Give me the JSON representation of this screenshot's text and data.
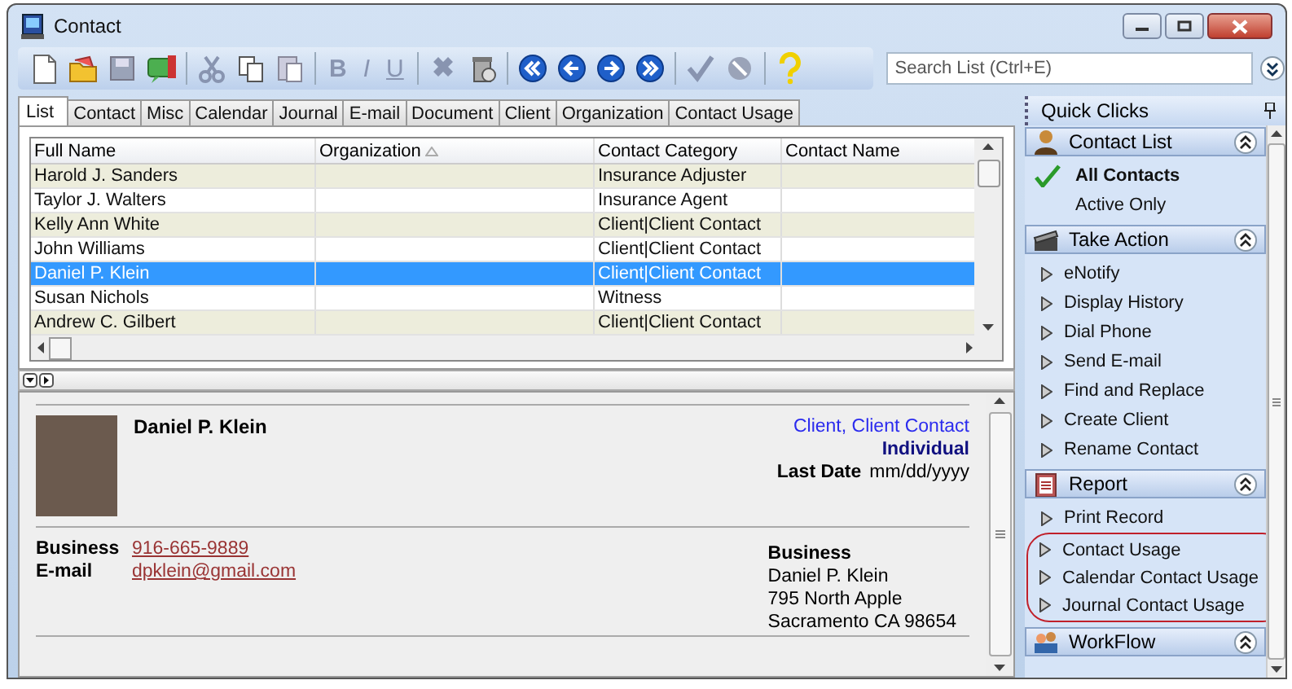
{
  "window": {
    "title": "Contact"
  },
  "toolbar": {
    "format_buttons": [
      "B",
      "I",
      "U"
    ],
    "search": {
      "placeholder": "Search List (Ctrl+E)"
    }
  },
  "tabs": [
    {
      "label": "List",
      "selected": true
    },
    {
      "label": "Contact",
      "selected": false
    },
    {
      "label": "Misc",
      "selected": false
    },
    {
      "label": "Calendar",
      "selected": false
    },
    {
      "label": "Journal",
      "selected": false
    },
    {
      "label": "E-mail",
      "selected": false
    },
    {
      "label": "Document",
      "selected": false
    },
    {
      "label": "Client",
      "selected": false
    },
    {
      "label": "Organization",
      "selected": false
    },
    {
      "label": "Contact Usage",
      "selected": false
    }
  ],
  "table": {
    "columns": [
      {
        "label": "Full Name",
        "sorted": false
      },
      {
        "label": "Organization",
        "sorted": true
      },
      {
        "label": "Contact Category",
        "sorted": false
      },
      {
        "label": "Contact Name",
        "sorted": false
      }
    ],
    "rows": [
      {
        "full_name": "Harold J. Sanders",
        "contact_category": "Insurance Adjuster",
        "selected": false
      },
      {
        "full_name": "Taylor J. Walters",
        "contact_category": "Insurance Agent",
        "selected": false
      },
      {
        "full_name": "Kelly Ann White",
        "contact_category": "Client|Client Contact",
        "selected": false
      },
      {
        "full_name": "John Williams",
        "contact_category": "Client|Client Contact",
        "selected": false
      },
      {
        "full_name": "Daniel P. Klein",
        "contact_category": "Client|Client Contact",
        "selected": true
      },
      {
        "full_name": "Susan Nichols",
        "contact_category": "Witness",
        "selected": false
      },
      {
        "full_name": "Andrew C. Gilbert",
        "contact_category": "Client|Client Contact",
        "selected": false
      }
    ]
  },
  "detail": {
    "name": "Daniel P. Klein",
    "category": "Client, Client Contact",
    "type": "Individual",
    "last_date_label": "Last Date",
    "last_date": "mm/dd/yyyy",
    "phone_label": "Business",
    "phone": "916-665-9889",
    "email_label": "E-mail",
    "email": "dpklein@gmail.com",
    "address_label": "Business",
    "address_lines": [
      "Daniel P. Klein",
      "795 North Apple",
      "Sacramento  CA  98654"
    ]
  },
  "quick_clicks": {
    "title": "Quick Clicks",
    "sections": [
      {
        "title": "Contact List",
        "items": [
          {
            "label": "All Contacts",
            "kind": "filter",
            "selected": true,
            "circled": false
          },
          {
            "label": "Active Only",
            "kind": "filter",
            "selected": false,
            "circled": false
          }
        ]
      },
      {
        "title": "Take Action",
        "items": [
          {
            "label": "eNotify",
            "kind": "action",
            "circled": false
          },
          {
            "label": "Display History",
            "kind": "action",
            "circled": false
          },
          {
            "label": "Dial Phone",
            "kind": "action",
            "circled": false
          },
          {
            "label": "Send E-mail",
            "kind": "action",
            "circled": false
          },
          {
            "label": "Find and Replace",
            "kind": "action",
            "circled": false
          },
          {
            "label": "Create Client",
            "kind": "action",
            "circled": false
          },
          {
            "label": "Rename Contact",
            "kind": "action",
            "circled": false
          }
        ]
      },
      {
        "title": "Report",
        "items": [
          {
            "label": "Print Record",
            "kind": "action",
            "circled": false
          },
          {
            "label": "Contact Usage",
            "kind": "action",
            "circled": true
          },
          {
            "label": "Calendar Contact Usage",
            "kind": "action",
            "circled": true
          },
          {
            "label": "Journal Contact Usage",
            "kind": "action",
            "circled": true
          }
        ]
      },
      {
        "title": "WorkFlow"
      }
    ]
  }
}
